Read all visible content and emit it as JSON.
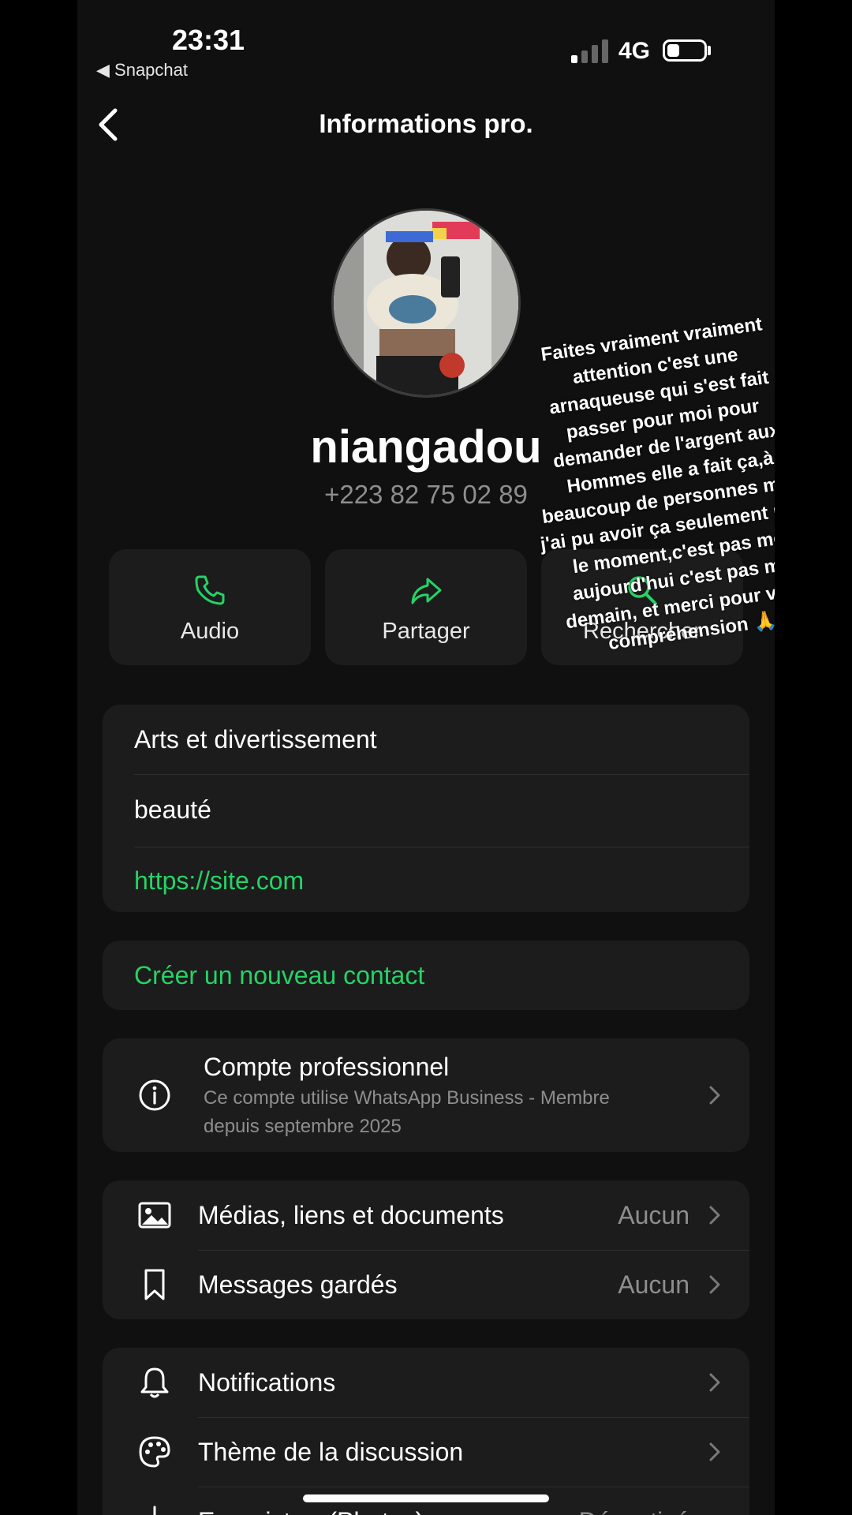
{
  "status_bar": {
    "time": "23:31",
    "back_app": "◀ Snapchat",
    "network": "4G",
    "battery_level": 0.35
  },
  "nav": {
    "title": "Informations pro."
  },
  "profile": {
    "name": "niangadou",
    "phone": "+223 82 75 02 89"
  },
  "actions": [
    {
      "label": "Audio",
      "icon": "phone-icon"
    },
    {
      "label": "Partager",
      "icon": "share-icon"
    },
    {
      "label": "Rechercher",
      "icon": "search-icon"
    }
  ],
  "business_info": {
    "category": "Arts et divertissement",
    "description": "beauté",
    "website": "https://site.com"
  },
  "create_contact": "Créer un nouveau contact",
  "pro_account": {
    "title": "Compte professionnel",
    "subtitle_line1": "Ce compte utilise WhatsApp Business - Membre",
    "subtitle_line2": "depuis septembre 2025"
  },
  "media_section": {
    "media_label": "Médias, liens et documents",
    "media_value": "Aucun",
    "saved_label": "Messages gardés",
    "saved_value": "Aucun"
  },
  "settings_section": {
    "notifications": "Notifications",
    "theme": "Thème de la discussion",
    "save_photos": "Enregistrer (Photos)",
    "save_photos_value": "Désactivé"
  },
  "caption_lines": [
    "Faites vraiment vraiment",
    "attention c'est une",
    "arnaqueuse qui s'est fait",
    "passer pour moi pour",
    "demander de l'argent aux",
    "Hommes  elle a fait ça,à",
    "beaucoup de personnes mais",
    "j'ai pu avoir ça seulement pour",
    "le moment,c'est pas moi",
    "aujourd'hui c'est pas moi",
    "demain, et merci pour votre",
    "compréhension 🙏"
  ],
  "colors": {
    "accent": "#25d366",
    "card": "#1c1c1c",
    "background": "#101010"
  }
}
